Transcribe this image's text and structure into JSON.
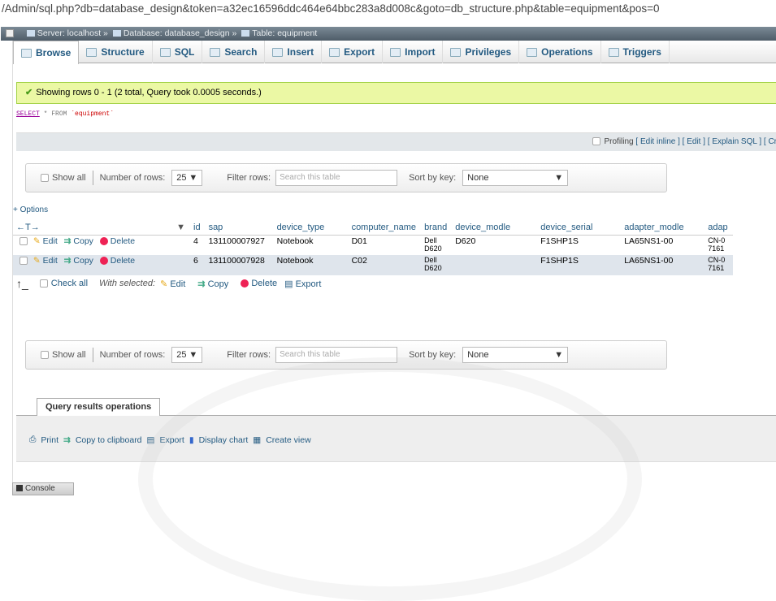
{
  "url": "/Admin/sql.php?db=database_design&token=a32ec16596ddc464e64bbc283a8d008c&goto=db_structure.php&table=equipment&pos=0",
  "breadcrumb": {
    "server": "Server: localhost",
    "database": "Database: database_design",
    "table": "Table: equipment"
  },
  "tabs": [
    "Browse",
    "Structure",
    "SQL",
    "Search",
    "Insert",
    "Export",
    "Import",
    "Privileges",
    "Operations",
    "Triggers"
  ],
  "success_message": "Showing rows 0 - 1 (2 total, Query took 0.0005 seconds.)",
  "sql": {
    "keyword": "SELECT",
    "rest": " * FROM ",
    "table": "`equipment`"
  },
  "profiling": {
    "label": "Profiling",
    "links": "[ Edit inline ] [ Edit ] [ Explain SQL ] [ Cr"
  },
  "nav": {
    "show_all": "Show all",
    "number_of_rows_label": "Number of rows:",
    "number_of_rows_value": "25",
    "filter_label": "Filter rows:",
    "filter_placeholder": "Search this table",
    "sort_label": "Sort by key:",
    "sort_value": "None"
  },
  "options_label": "+ Options",
  "table": {
    "arrows": "←T→",
    "headers": [
      "id",
      "sap",
      "device_type",
      "computer_name",
      "brand",
      "device_modle",
      "device_serial",
      "adapter_modle",
      "adap"
    ],
    "rows": [
      {
        "id": "4",
        "sap": "131100007927",
        "device_type": "Notebook",
        "computer_name": "D01",
        "brand_1": "Dell",
        "brand_2": "D620",
        "device_modle": "D620",
        "device_serial": "F1SHP1S",
        "adapter_modle": "LA65NS1-00",
        "adap_1": "CN-0",
        "adap_2": "7161"
      },
      {
        "id": "6",
        "sap": "131100007928",
        "device_type": "Notebook",
        "computer_name": "C02",
        "brand_1": "Dell",
        "brand_2": "D620",
        "device_modle": "",
        "device_serial": "F1SHP1S",
        "adapter_modle": "LA65NS1-00",
        "adap_1": "CN-0",
        "adap_2": "7161"
      }
    ],
    "actions": {
      "edit": "Edit",
      "copy": "Copy",
      "delete": "Delete"
    }
  },
  "bulk": {
    "check_all": "Check all",
    "with_selected": "With selected:",
    "edit": "Edit",
    "copy": "Copy",
    "delete": "Delete",
    "export": "Export"
  },
  "query_ops": {
    "title": "Query results operations",
    "print": "Print",
    "copy": "Copy to clipboard",
    "export": "Export",
    "chart": "Display chart",
    "view": "Create view"
  },
  "console": "Console"
}
